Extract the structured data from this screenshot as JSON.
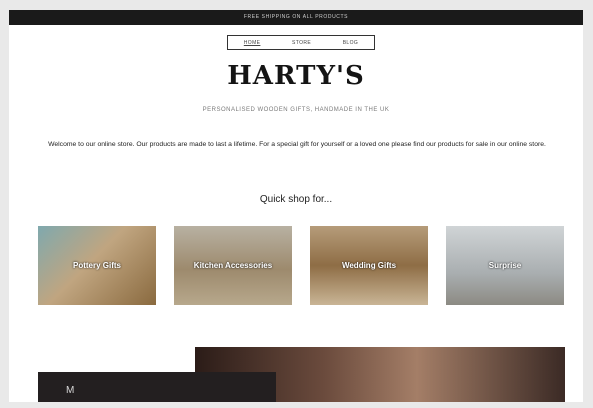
{
  "topbar": {
    "text": "FREE SHIPPING ON ALL PRODUCTS"
  },
  "nav": {
    "items": [
      "HOME",
      "STORE",
      "BLOG"
    ]
  },
  "brand": {
    "logo": "HARTY'S",
    "tagline": "PERSONALISED WOODEN GIFTS, HANDMADE IN THE UK"
  },
  "welcome": "Welcome to our online store. Our products are made to last a lifetime. For a special gift for yourself or a loved one please find our products for sale in our online store.",
  "quick_shop": {
    "heading": "Quick shop for...",
    "tiles": [
      {
        "label": "Pottery Gifts"
      },
      {
        "label": "Kitchen Accessories"
      },
      {
        "label": "Wedding Gifts"
      },
      {
        "label": "Surprise"
      }
    ]
  },
  "hero": {
    "overlay_text": "M"
  }
}
